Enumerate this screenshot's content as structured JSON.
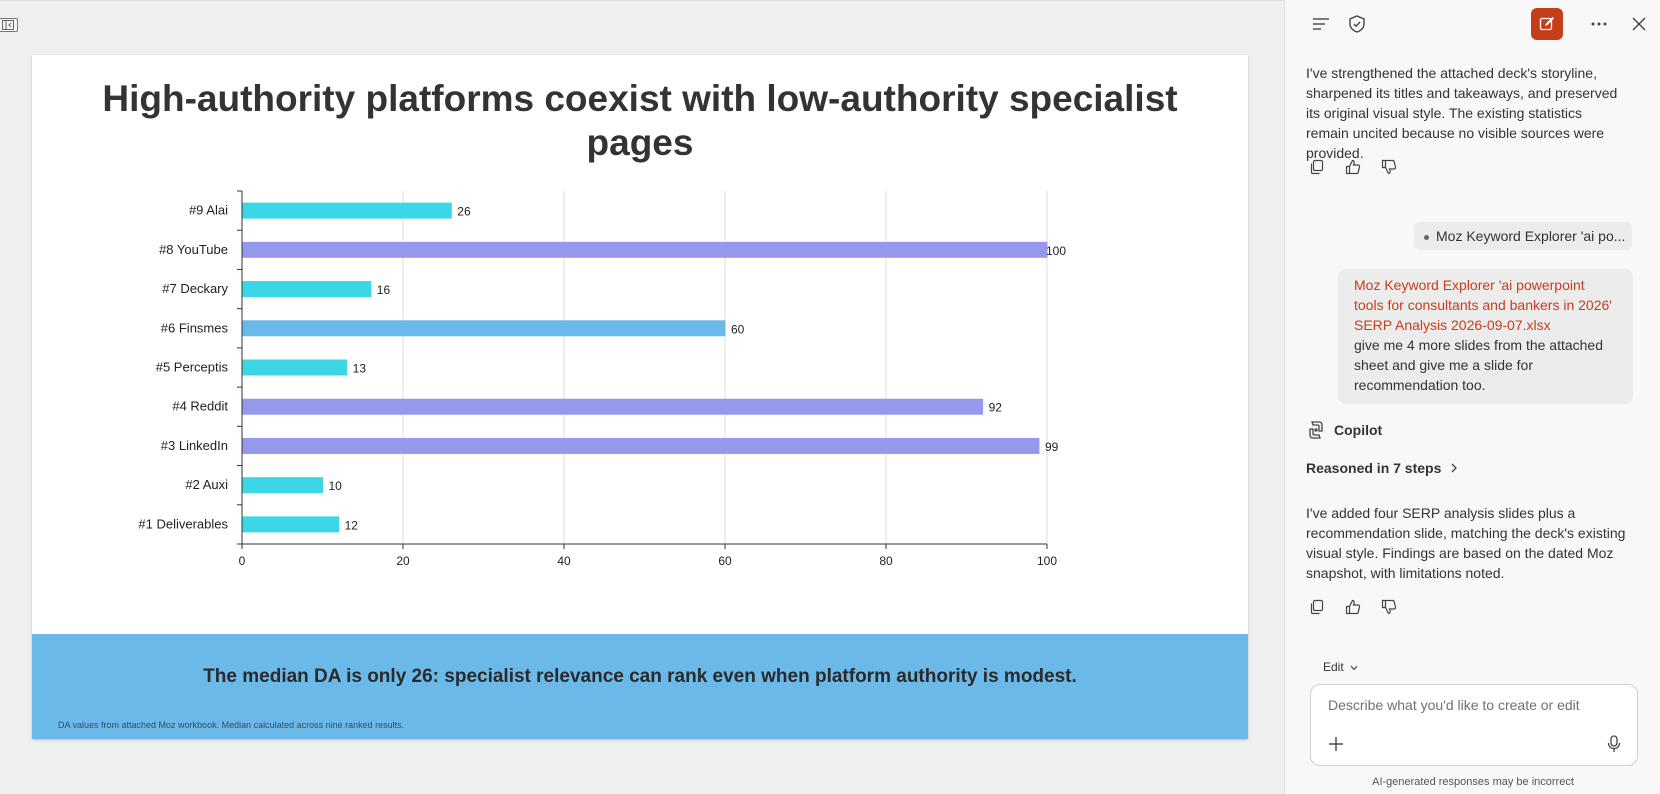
{
  "slide": {
    "title": "High-authority platforms coexist with low-authority specialist pages",
    "takeaway": "The median DA is only 26: specialist relevance can rank even when platform authority is modest.",
    "source_note": "DA values from attached Moz workbook. Median calculated across nine ranked results."
  },
  "chart_data": {
    "type": "bar",
    "orientation": "horizontal",
    "categories": [
      "#9 Alai",
      "#8 YouTube",
      "#7 Deckary",
      "#6 Finsmes",
      "#5 Perceptis",
      "#4 Reddit",
      "#3 LinkedIn",
      "#2 Auxi",
      "#1 Deliverables"
    ],
    "values": [
      26,
      100,
      16,
      60,
      13,
      92,
      99,
      10,
      12
    ],
    "bar_colors": [
      "#3dd6e6",
      "#9599ec",
      "#3dd6e6",
      "#6bb9e9",
      "#3dd6e6",
      "#9599ec",
      "#9599ec",
      "#3dd6e6",
      "#3dd6e6"
    ],
    "xlim": [
      0,
      100
    ],
    "x_ticks": [
      "0",
      "20",
      "40",
      "60",
      "80",
      "100"
    ],
    "grid": true,
    "xlabel": "",
    "ylabel": ""
  },
  "panel": {
    "icons": {
      "menu": "menu-lines-icon",
      "shield": "shield-check-icon",
      "compose": "compose-icon",
      "more": "more-icon",
      "close": "close-icon"
    },
    "messages": {
      "first_response": "I've strengthened the attached deck's storyline, sharpened its titles and takeaways, and preserved its original visual style. The existing statistics remain uncited because no visible sources were provided.",
      "chip": "Moz Keyword Explorer 'ai po...",
      "user_attachment": "Moz Keyword Explorer 'ai powerpoint tools for consultants and bankers in 2026' SERP Analysis 2026-09-07.xlsx",
      "user_request": "give me 4 more slides from the attached sheet and give me a slide for recommendation too.",
      "assistant_name": "Copilot",
      "reasoning": "Reasoned in 7 steps",
      "second_response": "I've added four SERP analysis slides plus a recommendation slide, matching the deck's existing visual style. Findings are based on the dated Moz snapshot, with limitations noted."
    },
    "mode_label": "Edit",
    "input_placeholder": "Describe what you'd like to create or edit",
    "disclaimer": "AI-generated responses may be incorrect"
  },
  "colors": {
    "accent": "#c43e1c",
    "footer_band": "#6bb9e9",
    "bar_cyan": "#3dd6e6",
    "bar_lavender": "#9599ec",
    "bar_blue": "#6bb9e9"
  }
}
